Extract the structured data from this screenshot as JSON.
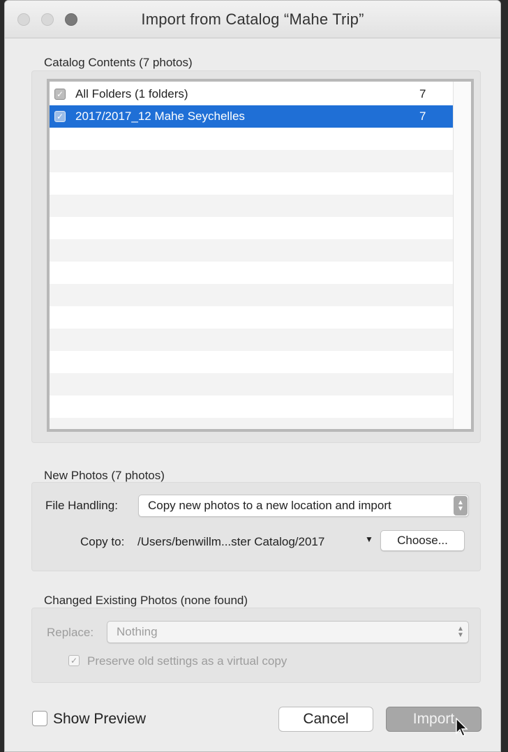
{
  "window": {
    "title": "Import from Catalog “Mahe Trip”"
  },
  "catalog_contents": {
    "label": "Catalog Contents (7 photos)",
    "rows": [
      {
        "label": "All Folders (1 folders)",
        "count": "7",
        "checked": true,
        "selected": false
      },
      {
        "label": "2017/2017_12 Mahe Seychelles",
        "count": "7",
        "checked": true,
        "selected": true
      }
    ]
  },
  "new_photos": {
    "label": "New Photos (7 photos)",
    "file_handling_label": "File Handling:",
    "file_handling_value": "Copy new photos to a new location and import",
    "copy_to_label": "Copy to:",
    "copy_to_path": "/Users/benwillm...ster Catalog/2017",
    "choose_button": "Choose..."
  },
  "changed_existing": {
    "label": "Changed Existing Photos (none found)",
    "replace_label": "Replace:",
    "replace_value": "Nothing",
    "preserve_label": "Preserve old settings as a virtual copy",
    "preserve_checked": true
  },
  "footer": {
    "show_preview_label": "Show Preview",
    "show_preview_checked": false,
    "cancel_button": "Cancel",
    "import_button": "Import"
  },
  "colors": {
    "selection": "#1f6fd6",
    "window_bg": "#ececec",
    "panel_bg": "#e4e4e4",
    "default_button": "#a7a7a7"
  },
  "icons": [
    "close-traffic-light-icon",
    "minimize-traffic-light-icon",
    "zoom-traffic-light-icon",
    "checkmark-icon",
    "stepper-arrows-icon",
    "dropdown-triangle-icon",
    "mouse-pointer-icon"
  ]
}
